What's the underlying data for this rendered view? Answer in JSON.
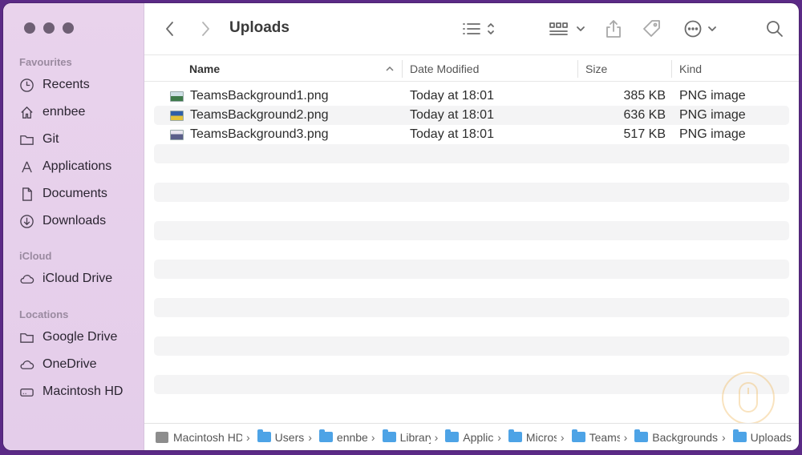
{
  "window": {
    "title": "Uploads"
  },
  "sidebar": {
    "favourites_title": "Favourites",
    "favourites": [
      {
        "label": "Recents",
        "icon": "clock-icon"
      },
      {
        "label": "ennbee",
        "icon": "home-icon"
      },
      {
        "label": "Git",
        "icon": "folder-icon"
      },
      {
        "label": "Applications",
        "icon": "applications-icon"
      },
      {
        "label": "Documents",
        "icon": "document-icon"
      },
      {
        "label": "Downloads",
        "icon": "download-icon"
      }
    ],
    "icloud_title": "iCloud",
    "icloud": [
      {
        "label": "iCloud Drive",
        "icon": "cloud-icon"
      }
    ],
    "locations_title": "Locations",
    "locations": [
      {
        "label": "Google Drive",
        "icon": "folder-icon"
      },
      {
        "label": "OneDrive",
        "icon": "cloud-icon"
      },
      {
        "label": "Macintosh HD",
        "icon": "disk-icon"
      }
    ]
  },
  "columns": {
    "name": "Name",
    "date": "Date Modified",
    "size": "Size",
    "kind": "Kind"
  },
  "files": [
    {
      "name": "TeamsBackground1.png",
      "date": "Today at 18:01",
      "size": "385 KB",
      "kind": "PNG image"
    },
    {
      "name": "TeamsBackground2.png",
      "date": "Today at 18:01",
      "size": "636 KB",
      "kind": "PNG image"
    },
    {
      "name": "TeamsBackground3.png",
      "date": "Today at 18:01",
      "size": "517 KB",
      "kind": "PNG image"
    }
  ],
  "path": [
    {
      "label": "Macintosh HD",
      "icon": "disk-icon"
    },
    {
      "label": "Users",
      "icon": "folder-icon"
    },
    {
      "label": "ennbee",
      "icon": "home-folder-icon"
    },
    {
      "label": "Library",
      "icon": "folder-icon"
    },
    {
      "label": "Application Support",
      "icon": "folder-icon"
    },
    {
      "label": "Microsoft",
      "icon": "folder-icon"
    },
    {
      "label": "Teams",
      "icon": "folder-icon"
    },
    {
      "label": "Backgrounds",
      "icon": "folder-icon"
    },
    {
      "label": "Uploads",
      "icon": "folder-icon"
    }
  ],
  "colors": {
    "sidebar_bg": "#e9d3ec",
    "folder_blue": "#4da3e6",
    "desktop_purple": "#5b2a86"
  }
}
